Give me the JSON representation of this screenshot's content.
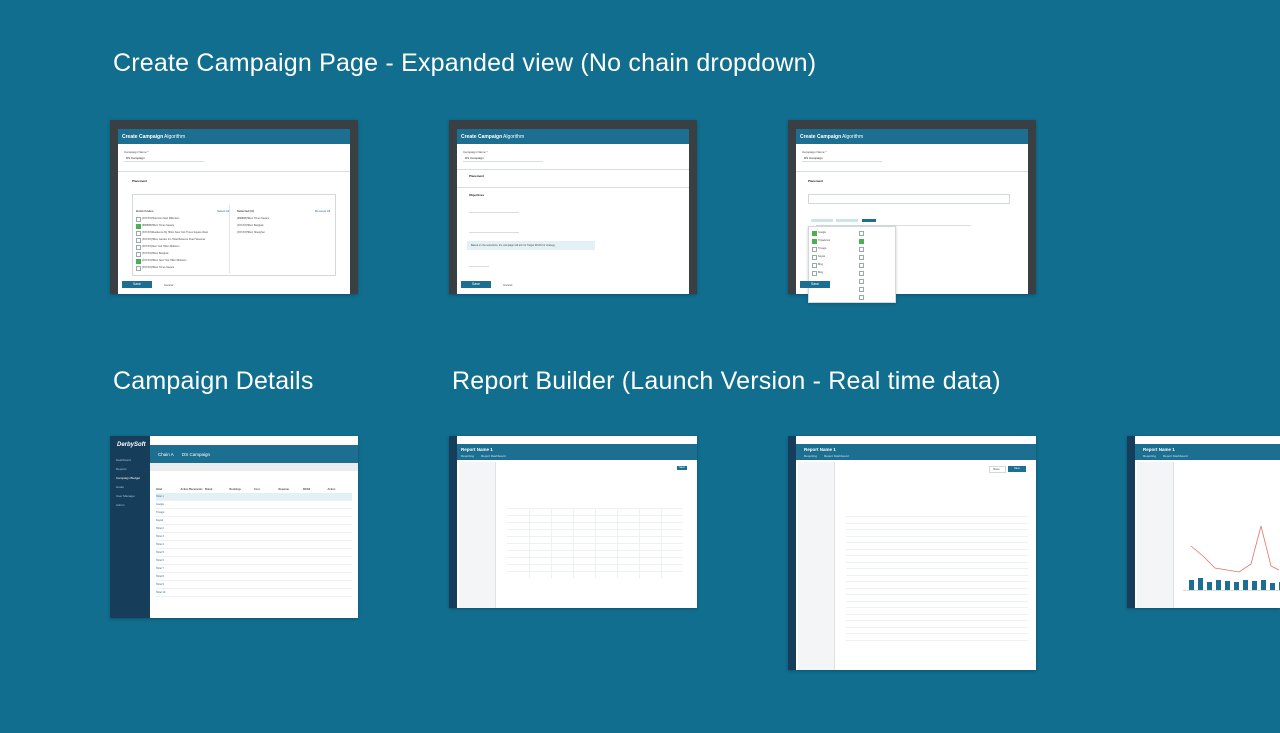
{
  "titles": {
    "create_campaign": "Create Campaign Page - Expanded view (No chain dropdown)",
    "campaign_details": "Campaign Details",
    "report_builder": "Report Builder (Launch Version - Real time data)"
  },
  "thumbs": {
    "cc1": {
      "header_title": "Create Campaign",
      "header_sub": "Algorithm",
      "campaign_name_label": "Campaign Name *",
      "campaign_name_value": "DS Campaign",
      "placement_label": "Placement",
      "list_left_header": "Hotel Codes",
      "list_left_link": "Select All",
      "list_right_header": "Selected (3)",
      "list_right_link": "Remove All",
      "left_items": [
        "[XXXXX]Hotel Ann Mari Millenium",
        "[888888]Hilton Times Square",
        "[XXXXX]Residence By Hilton New York Times Square West",
        "[XXXXX]Hilton Garden Inn Hotel Bellevue Pearl Slovenia",
        "[XXXXX]New York Hilton Midtown",
        "[XXXXX]Hilton Bangkok",
        "[XXXXX]Hilton New York Hilton Midtown",
        "[XXXXX]Hilton Times Square"
      ],
      "right_items": [
        "[888888]Hilton Times Square",
        "[XXXXX]Hilton Bangkok",
        "[XXXXX]Hilton Shanghai"
      ],
      "save_label": "Save",
      "cancel_label": "Cancel"
    },
    "cc2": {
      "header_title": "Create Campaign",
      "header_sub": "Algorithm",
      "campaign_name_label": "Campaign Name *",
      "campaign_name_value": "DS Campaign",
      "placement_label": "Placement",
      "objectives_label": "Objectives",
      "info_text": "Based on the selections, the campaign will aim for Target ROAS for strategy",
      "save_label": "Save",
      "cancel_label": "Cancel"
    },
    "cc3": {
      "header_title": "Create Campaign",
      "header_sub": "Algorithm",
      "campaign_name_label": "Campaign Name *",
      "campaign_name_value": "DS Campaign",
      "placement_label": "Placement",
      "dropdown_items": [
        "Google",
        "Tripadvisor",
        "Trivago",
        "Kayak",
        "Bing",
        "Bing"
      ],
      "save_label": "Save",
      "cancel_label": "Cancel"
    },
    "cd": {
      "logo": "DerbySoft",
      "breadcrumb_chain": "Chain A",
      "breadcrumb_campaign": "DS Campaign",
      "nav_items": [
        "Dashboard",
        "Reports",
        "Campaign Budget",
        "Goals",
        "User Manager",
        "Admin"
      ],
      "columns": [
        "Hotel",
        "Active Placements",
        "Brand",
        "Bookings",
        "Cost",
        "Revenue",
        "ROAS",
        "Action"
      ],
      "rows": [
        "Hotel 1",
        "Google",
        "Trivago",
        "Kayak",
        "Hotel 2",
        "Hotel 3",
        "Hotel 4",
        "Hotel 5",
        "Hotel 6",
        "Hotel 7",
        "Hotel 8",
        "Hotel 9",
        "Hotel 10"
      ]
    },
    "rb1": {
      "title": "Report Name 1",
      "tab1": "Reporting",
      "tab2": "Report Dashboard",
      "save_label": "Save"
    },
    "rb2": {
      "title": "Report Name 1",
      "tab1": "Reporting",
      "tab2": "Report Dashboard",
      "save_label": "Save",
      "share_label": "Share"
    },
    "rb3": {
      "title": "Report Name 1",
      "tab1": "Reporting",
      "tab2": "Report Dashboard"
    }
  }
}
